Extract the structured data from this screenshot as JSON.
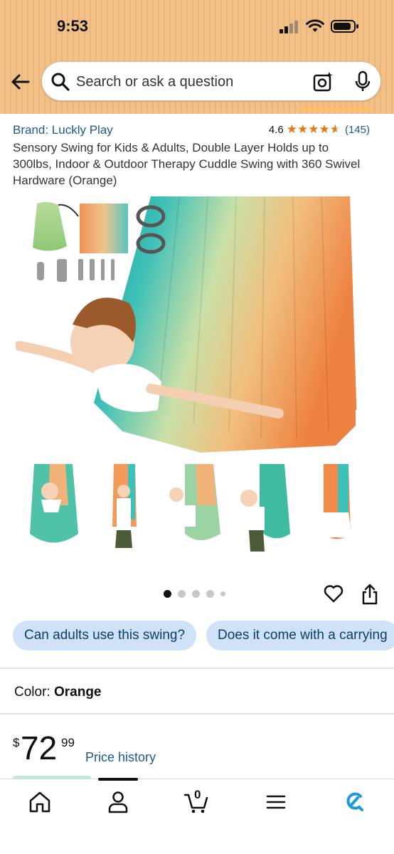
{
  "status_bar": {
    "time": "9:53"
  },
  "search": {
    "placeholder": "Search or ask a question"
  },
  "product": {
    "brand": "Brand: Luckly Play",
    "rating": "4.6",
    "rating_count": "(145)",
    "stars": "★★★★⯪",
    "title": "Sensory Swing for Kids & Adults, Double Layer Holds up to 300lbs, Indoor & Outdoor Therapy Cuddle Swing with 360 Swivel Hardware (Orange)",
    "image_count": 5,
    "active_image_index": 0
  },
  "questions": [
    {
      "label": "Can adults use this swing?"
    },
    {
      "label": "Does it come with a carrying"
    }
  ],
  "color": {
    "label": "Color: ",
    "value": "Orange"
  },
  "price": {
    "symbol": "$",
    "whole": "72",
    "fraction": "99",
    "history_link": "Price history"
  },
  "bottom_nav": {
    "items": [
      {
        "icon": "home-icon"
      },
      {
        "icon": "account-icon"
      },
      {
        "icon": "cart-icon",
        "badge": "0"
      },
      {
        "icon": "menu-icon"
      },
      {
        "icon": "rufus-icon"
      }
    ]
  },
  "colors": {
    "header": "#f2c187",
    "link": "#1d5a8a",
    "star": "#e47911",
    "chip_bg": "#cfe2f7",
    "rufus": "#1a9bd7"
  }
}
